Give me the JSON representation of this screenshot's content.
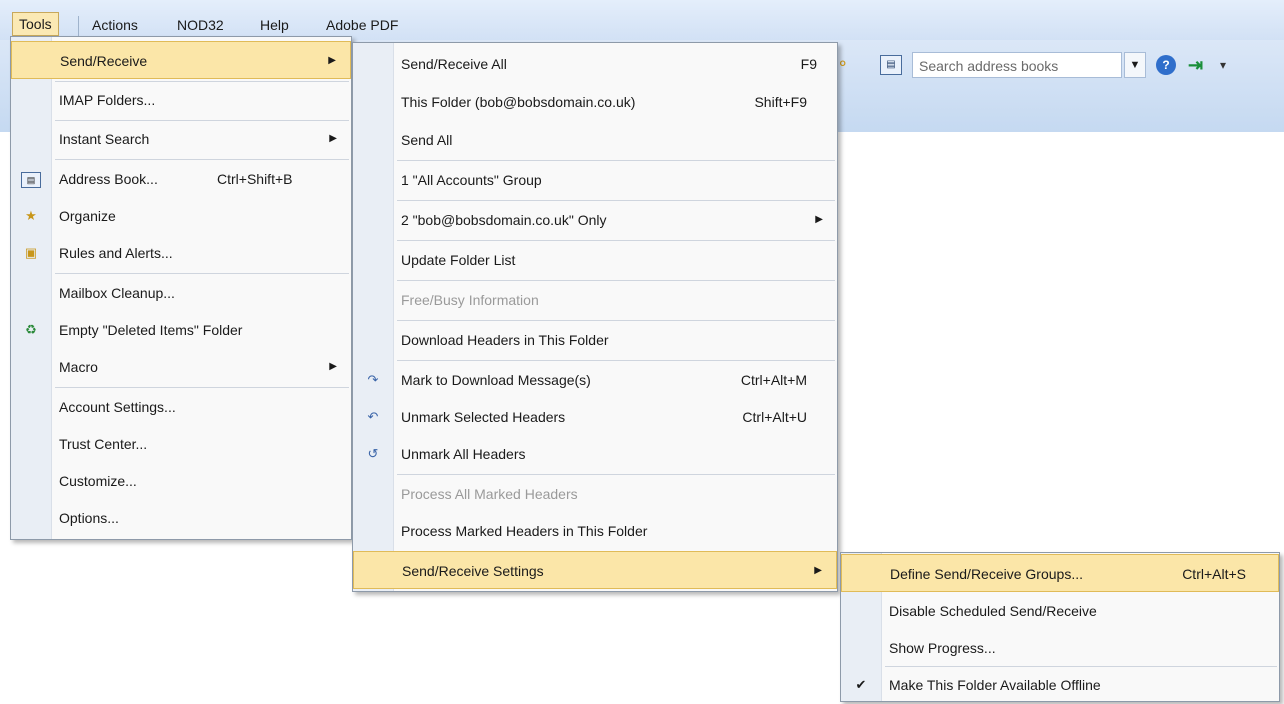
{
  "menubar": {
    "items": [
      {
        "label": "Tools"
      },
      {
        "label": "Actions"
      },
      {
        "label": "NOD32"
      },
      {
        "label": "Help"
      },
      {
        "label": "Adobe PDF"
      }
    ]
  },
  "toolbar": {
    "search_placeholder": "Search address books"
  },
  "tools_menu": {
    "items": [
      {
        "label": "Send/Receive"
      },
      {
        "label": "IMAP Folders..."
      },
      {
        "label": "Instant Search"
      },
      {
        "label": "Address Book...",
        "shortcut": "Ctrl+Shift+B"
      },
      {
        "label": "Organize"
      },
      {
        "label": "Rules and Alerts..."
      },
      {
        "label": "Mailbox Cleanup..."
      },
      {
        "label": "Empty \"Deleted Items\" Folder"
      },
      {
        "label": "Macro"
      },
      {
        "label": "Account Settings..."
      },
      {
        "label": "Trust Center..."
      },
      {
        "label": "Customize..."
      },
      {
        "label": "Options..."
      }
    ]
  },
  "sendreceive_menu": {
    "items": [
      {
        "label": "Send/Receive All",
        "shortcut": "F9"
      },
      {
        "label": "This Folder (bob@bobsdomain.co.uk)",
        "shortcut": "Shift+F9"
      },
      {
        "label": "Send All"
      },
      {
        "label": "1 \"All Accounts\" Group"
      },
      {
        "label": "2 \"bob@bobsdomain.co.uk\" Only"
      },
      {
        "label": "Update Folder List"
      },
      {
        "label": "Free/Busy Information"
      },
      {
        "label": "Download Headers in This Folder"
      },
      {
        "label": "Mark to Download Message(s)",
        "shortcut": "Ctrl+Alt+M"
      },
      {
        "label": "Unmark Selected Headers",
        "shortcut": "Ctrl+Alt+U"
      },
      {
        "label": "Unmark All Headers"
      },
      {
        "label": "Process All Marked Headers"
      },
      {
        "label": "Process Marked Headers in This Folder"
      },
      {
        "label": "Send/Receive Settings"
      }
    ]
  },
  "settings_menu": {
    "items": [
      {
        "label": "Define Send/Receive Groups...",
        "shortcut": "Ctrl+Alt+S"
      },
      {
        "label": "Disable Scheduled Send/Receive"
      },
      {
        "label": "Show Progress..."
      },
      {
        "label": "Make This Folder Available Offline"
      }
    ]
  }
}
